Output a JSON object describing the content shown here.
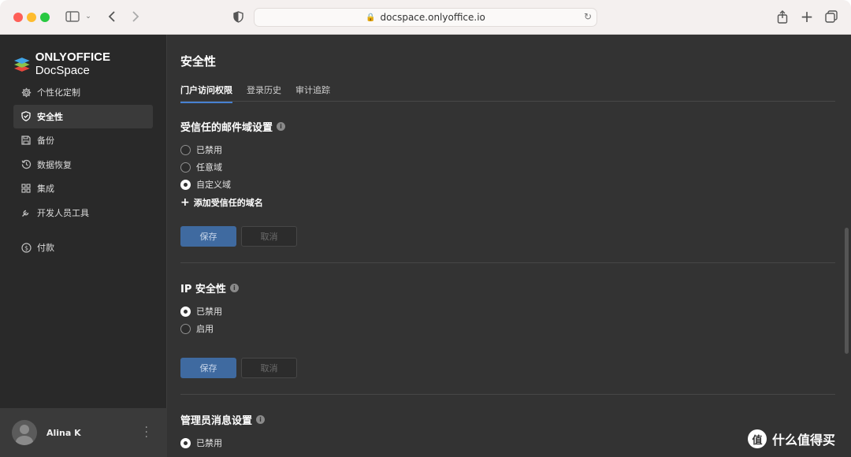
{
  "browser": {
    "url": "docspace.onlyoffice.io"
  },
  "app": {
    "logo_bold": "ONLYOFFICE",
    "logo_light": " DocSpace"
  },
  "sidebar": {
    "items": [
      {
        "label": "个性化定制",
        "icon": "gear-icon"
      },
      {
        "label": "安全性",
        "icon": "shield-icon"
      },
      {
        "label": "备份",
        "icon": "floppy-icon"
      },
      {
        "label": "数据恢复",
        "icon": "history-icon"
      },
      {
        "label": "集成",
        "icon": "grid-icon"
      },
      {
        "label": "开发人员工具",
        "icon": "wrench-icon"
      },
      {
        "label": "付款",
        "icon": "dollar-icon"
      }
    ],
    "user_name": "Alina K"
  },
  "main": {
    "title": "安全性",
    "tabs": [
      {
        "label": "门户访问权限"
      },
      {
        "label": "登录历史"
      },
      {
        "label": "审计追踪"
      }
    ],
    "trusted_domain": {
      "title": "受信任的邮件域设置",
      "options": [
        "已禁用",
        "任意域",
        "自定义域"
      ],
      "selected": "自定义域",
      "add_link": "添加受信任的域名",
      "save": "保存",
      "cancel": "取消"
    },
    "ip_security": {
      "title": "IP 安全性",
      "options": [
        "已禁用",
        "启用"
      ],
      "selected": "已禁用",
      "save": "保存",
      "cancel": "取消"
    },
    "admin_message": {
      "title": "管理员消息设置",
      "options": [
        "已禁用"
      ],
      "selected": "已禁用"
    }
  },
  "watermark": {
    "text": "什么值得买",
    "logo_glyph": "值"
  }
}
